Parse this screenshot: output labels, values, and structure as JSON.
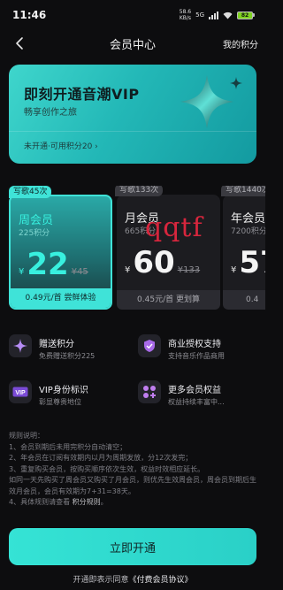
{
  "status_bar": {
    "time": "11:46",
    "net_speed_value": "58.6",
    "net_speed_unit": "KB/s",
    "network_type": "5G",
    "battery": "82"
  },
  "nav": {
    "title": "会员中心",
    "right_action": "我的积分"
  },
  "banner": {
    "title": "即刻开通音潮VIP",
    "subtitle": "畅享创作之旅",
    "status": "未开通·可用积分20 ›"
  },
  "plans": [
    {
      "tag": "写歌45次",
      "name": "周会员",
      "points": "225积分",
      "currency": "¥",
      "price": "22",
      "original": "¥45",
      "footer": "0.49元/首 尝鲜体验",
      "selected": true
    },
    {
      "tag": "写歌133次",
      "name": "月会员",
      "points": "665积分",
      "currency": "¥",
      "price": "60",
      "original": "¥133",
      "footer": "0.45元/首 更划算",
      "selected": false
    },
    {
      "tag": "写歌1440次",
      "name": "年会员",
      "points": "7200积分",
      "currency": "¥",
      "price": "57",
      "original": "",
      "footer": "0.4",
      "selected": false
    }
  ],
  "watermark": "qqtf",
  "benefits": [
    {
      "title": "赠送积分",
      "desc": "免费赠送积分225",
      "icon": "sparkle-icon"
    },
    {
      "title": "商业授权支持",
      "desc": "支持音乐作品商用",
      "icon": "shield-check-icon"
    },
    {
      "title": "VIP身份标识",
      "desc": "彰显尊贵地位",
      "icon": "vip-badge-icon"
    },
    {
      "title": "更多会员权益",
      "desc": "权益持续丰富中...",
      "icon": "grid-plus-icon"
    }
  ],
  "rules": {
    "heading": "规则说明：",
    "lines": [
      "1、会员到期后未用完积分自动清空；",
      "2、年会员在订阅有效期内以月为周期发放，分12次发完；",
      "3、重复购买会员，按购买顺序依次生效，权益时效相应延长。",
      "如同一天先购买了周会员又购买了月会员，则优先生效周会员，周会员到期后生效月会员，会员有效期为7+31=38天。",
      "4、具体规则请查看"
    ],
    "link": "积分规则",
    "link_suffix": "。"
  },
  "cta": {
    "label": "立即开通"
  },
  "agreement": {
    "prefix": "开通即表示同意",
    "link": "《付费会员协议》"
  },
  "colors": {
    "accent": "#38f0df",
    "background": "#0d0d0f"
  }
}
